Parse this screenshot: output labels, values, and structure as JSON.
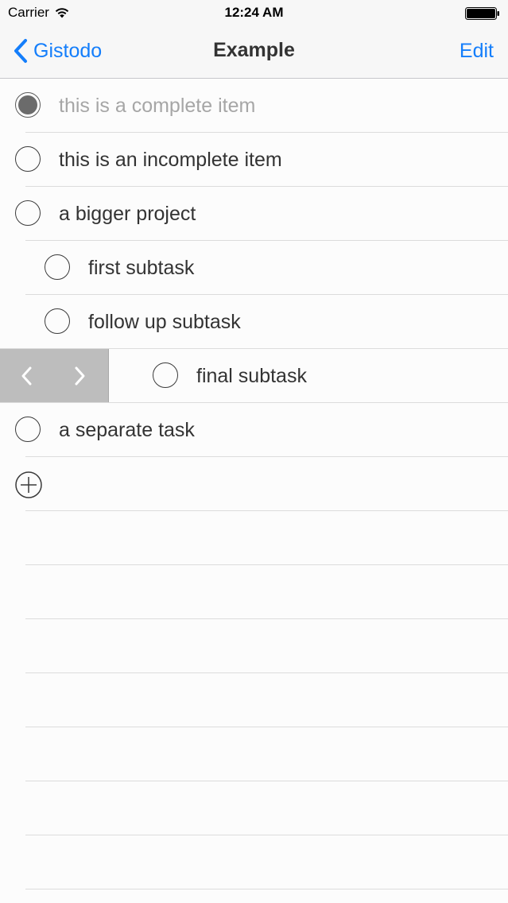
{
  "status_bar": {
    "carrier": "Carrier",
    "time": "12:24 AM"
  },
  "nav": {
    "back_label": "Gistodo",
    "title": "Example",
    "edit_label": "Edit",
    "accent_color": "#147efb"
  },
  "items": [
    {
      "label": "this is a complete item",
      "completed": true,
      "level": 0
    },
    {
      "label": "this is an incomplete item",
      "completed": false,
      "level": 0
    },
    {
      "label": "a bigger project",
      "completed": false,
      "level": 0
    },
    {
      "label": "first subtask",
      "completed": false,
      "level": 1
    },
    {
      "label": "follow up subtask",
      "completed": false,
      "level": 1
    },
    {
      "label": "final subtask",
      "completed": false,
      "level": 1
    },
    {
      "label": "a separate task",
      "completed": false,
      "level": 0
    }
  ],
  "indent_controls": {
    "outdent_icon": "chevron-left-icon",
    "indent_icon": "chevron-right-icon"
  },
  "add_item_icon": "plus-circle-icon"
}
